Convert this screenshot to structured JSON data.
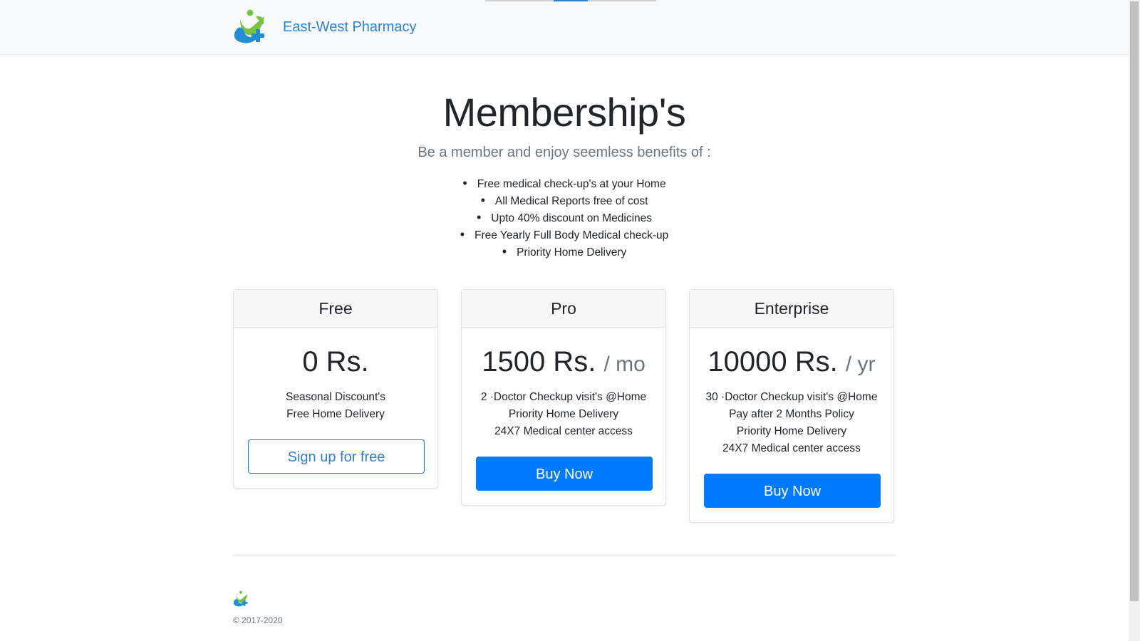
{
  "brand": {
    "name": "East-West Pharmacy",
    "logo_icon": "pharmacy-logo-icon"
  },
  "hero": {
    "title": "Membership's",
    "subtitle": "Be a member and enjoy seemless benefits of :",
    "benefits": [
      "Free medical check-up's at your Home",
      "All Medical Reports free of cost",
      "Upto 40% discount on Medicines",
      "Free Yearly Full Body Medical check-up",
      "Priority Home Delivery"
    ]
  },
  "plans": [
    {
      "name": "Free",
      "price": "0 Rs.",
      "period": "",
      "features": [
        "Seasonal Discount's",
        "Free Home Delivery"
      ],
      "button": "Sign up for free"
    },
    {
      "name": "Pro",
      "price": "1500 Rs.",
      "period": "/ mo",
      "features": [
        "2 ·Doctor Checkup visit's @Home",
        "Priority Home Delivery",
        "24X7 Medical center access"
      ],
      "button": "Buy Now"
    },
    {
      "name": "Enterprise",
      "price": "10000 Rs.",
      "period": "/ yr",
      "features": [
        "30 ·Doctor Checkup visit's @Home",
        "Pay after 2 Months Policy",
        "Priority Home Delivery",
        "24X7 Medical center access"
      ],
      "button": "Buy Now"
    }
  ],
  "footer": {
    "copyright": "© 2017-2020"
  },
  "colors": {
    "primary": "#007bff",
    "link": "#2f80c9",
    "logo_green": "#7cc242",
    "logo_blue": "#1f8fd1"
  }
}
